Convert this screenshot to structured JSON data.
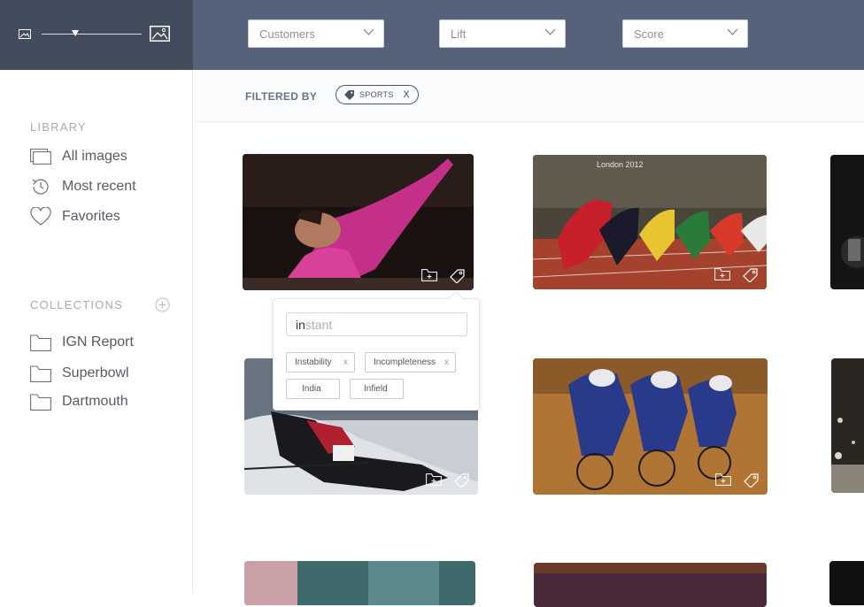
{
  "filters": {
    "dropdowns": [
      {
        "value": "Customers"
      },
      {
        "value": "Lift"
      },
      {
        "value": "Score"
      }
    ],
    "filtered_by_label": "FILTERED BY",
    "active_chip": "SPORTS",
    "chip_remove": "X"
  },
  "thumbnail_size": {
    "level": 0.34
  },
  "sidebar": {
    "library_title": "LIBRARY",
    "library_items": [
      {
        "label": "All images",
        "icon": "images-icon"
      },
      {
        "label": "Most recent",
        "icon": "history-icon"
      },
      {
        "label": "Favorites",
        "icon": "heart-icon"
      }
    ],
    "collections_title": "COLLECTIONS",
    "collections": [
      {
        "label": "IGN Report",
        "icon": "folder-icon"
      },
      {
        "label": "Superbowl",
        "icon": "folder-icon"
      },
      {
        "label": "Dartmouth",
        "icon": "folder-icon"
      }
    ]
  },
  "tag_popup": {
    "input_typed": "in",
    "input_suggestion": "stant",
    "tags": [
      {
        "label": "Instability",
        "remove": "x"
      },
      {
        "label": "Incompleteness",
        "remove": "x"
      },
      {
        "label": "India"
      },
      {
        "label": "Infield"
      }
    ]
  },
  "colors": {
    "topbar_dark": "#424c5d",
    "topbar": "#56627a",
    "accent_chip_border": "#4a5466"
  }
}
